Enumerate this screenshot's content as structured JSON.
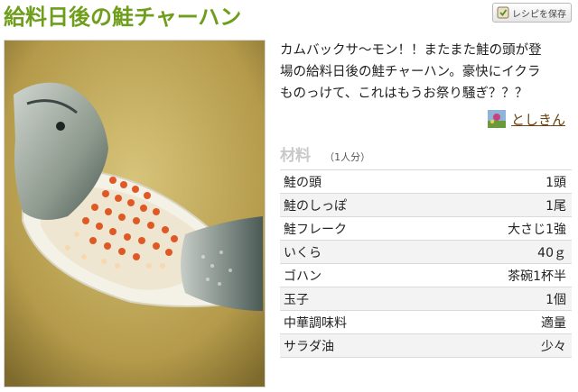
{
  "page": {
    "title": "給料日後の鮭チャーハン",
    "save_button_label": "レシピを保存",
    "icons": {
      "save": "save-icon",
      "author_avatar": "avatar-icon"
    }
  },
  "photo": {
    "alt": ""
  },
  "description": {
    "lines": [
      "カムバックサ〜モン！！またまた鮭の頭が登",
      "場の給料日後の鮭チャーハン。豪快にイクラ",
      "ものっけて、これはもうお祭り騒ぎ？？？"
    ]
  },
  "author": {
    "name": "としきん"
  },
  "ingredients": {
    "heading": "材料",
    "servings": "（1人分）",
    "items": [
      {
        "name": "鮭の頭",
        "quantity": "1頭"
      },
      {
        "name": "鮭のしっぽ",
        "quantity": "1尾"
      },
      {
        "name": "鮭フレーク",
        "quantity": "大さじ1強"
      },
      {
        "name": "いくら",
        "quantity": "40ｇ"
      },
      {
        "name": "ゴハン",
        "quantity": "茶碗1杯半"
      },
      {
        "name": "玉子",
        "quantity": "1個"
      },
      {
        "name": "中華調味料",
        "quantity": "適量"
      },
      {
        "name": "サラダ油",
        "quantity": "少々"
      }
    ]
  }
}
